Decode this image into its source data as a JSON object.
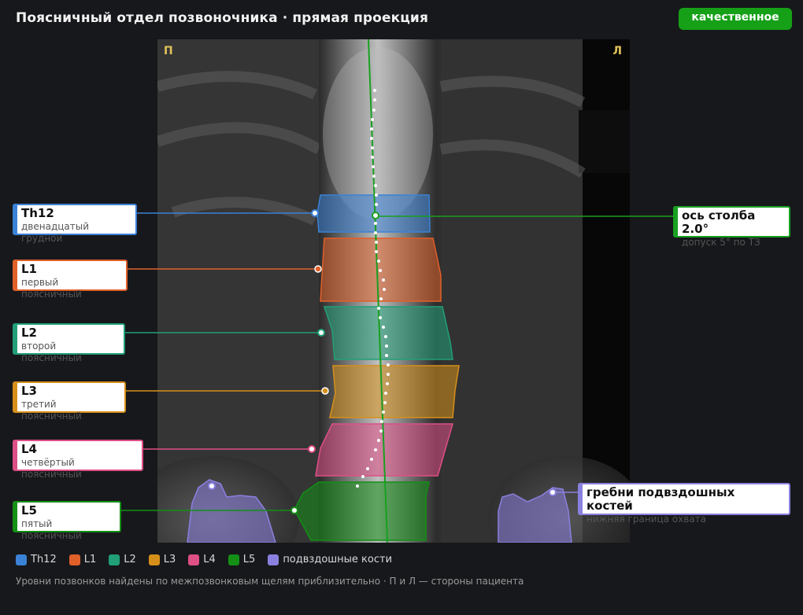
{
  "header": {
    "title": "Поясничный отдел позвоночника · прямая проекция",
    "quality_badge": "качественное"
  },
  "image": {
    "side_right_patient": "П",
    "side_left_patient": "Л"
  },
  "vertebrae": [
    {
      "id": "Th12",
      "name": "Th12",
      "desc": "двенадцатый грудной",
      "color": "#3b82d6"
    },
    {
      "id": "L1",
      "name": "L1",
      "desc": "первый поясничный",
      "color": "#e0602a"
    },
    {
      "id": "L2",
      "name": "L2",
      "desc": "второй поясничный",
      "color": "#21a078"
    },
    {
      "id": "L3",
      "name": "L3",
      "desc": "третий поясничный",
      "color": "#d6901a"
    },
    {
      "id": "L4",
      "name": "L4",
      "desc": "четвёртый поясничный",
      "color": "#de4f86"
    },
    {
      "id": "L5",
      "name": "L5",
      "desc": "пятый поясничный",
      "color": "#139015"
    }
  ],
  "axis_annotation": {
    "title": "ось столба 2.0°",
    "desc": "допуск 5° по ТЗ",
    "color": "#18a020"
  },
  "iliac_annotation": {
    "title": "гребни подвздошных костей",
    "desc": "нижняя граница охвата",
    "color": "#8a80e0"
  },
  "legend": [
    {
      "label": "Th12",
      "color": "#3b82d6"
    },
    {
      "label": "L1",
      "color": "#e0602a"
    },
    {
      "label": "L2",
      "color": "#21a078"
    },
    {
      "label": "L3",
      "color": "#d6901a"
    },
    {
      "label": "L4",
      "color": "#de4f86"
    },
    {
      "label": "L5",
      "color": "#139015"
    },
    {
      "label": "подвздошные кости",
      "color": "#8a80e0"
    }
  ],
  "footnote": "Уровни позвонков найдены по межпозвонковым щелям приблизительно · П и Л — стороны пациента"
}
